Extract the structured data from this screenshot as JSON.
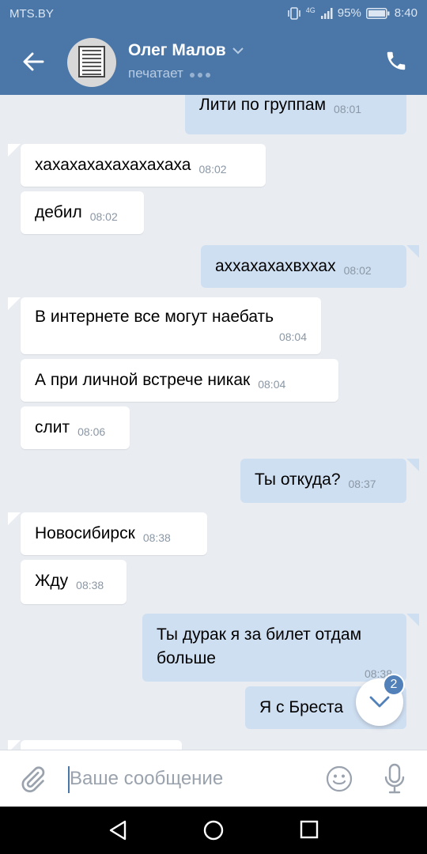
{
  "status_bar": {
    "carrier": "MTS.BY",
    "network": "4G",
    "battery": "95%",
    "time": "8:40",
    "icons": [
      "vibrate-icon",
      "signal-icon",
      "battery-icon"
    ]
  },
  "header": {
    "contact_name": "Олег Малов",
    "status": "печатает",
    "icons": [
      "back-arrow-icon",
      "chevron-down-icon",
      "phone-icon"
    ]
  },
  "messages": [
    {
      "dir": "out",
      "text": "Лити  по группам",
      "time": "08:01"
    },
    {
      "dir": "in",
      "text": "хахахахахахахахаха",
      "time": "08:02"
    },
    {
      "dir": "in",
      "text": "дебил",
      "time": "08:02"
    },
    {
      "dir": "out",
      "text": "аххахахахвххах",
      "time": "08:02"
    },
    {
      "dir": "in",
      "text": "В интернете все могут наебать",
      "time": "08:04"
    },
    {
      "dir": "in",
      "text": "А при личной встрече никак",
      "time": "08:04"
    },
    {
      "dir": "in",
      "text": "слит",
      "time": "08:06"
    },
    {
      "dir": "out",
      "text": "Ты откуда?",
      "time": "08:37"
    },
    {
      "dir": "in",
      "text": "Новосибирск",
      "time": "08:38"
    },
    {
      "dir": "in",
      "text": "Жду",
      "time": "08:38"
    },
    {
      "dir": "out",
      "text": "Ты дурак я за билет отдам больше",
      "time": "08:38"
    },
    {
      "dir": "out",
      "text": "Я с Бреста",
      "time": ""
    }
  ],
  "scroll_down": {
    "badge": "2"
  },
  "composer": {
    "placeholder": "Ваше сообщение",
    "icons": [
      "paperclip-icon",
      "emoji-icon",
      "microphone-icon"
    ]
  },
  "nav_bar": {
    "icons": [
      "back-icon",
      "home-icon",
      "recents-icon"
    ]
  },
  "colors": {
    "header": "#4a76a8",
    "outgoing_bubble": "#cfdff2",
    "incoming_bubble": "#ffffff",
    "background": "#e9edf2",
    "accent": "#5181b8"
  }
}
